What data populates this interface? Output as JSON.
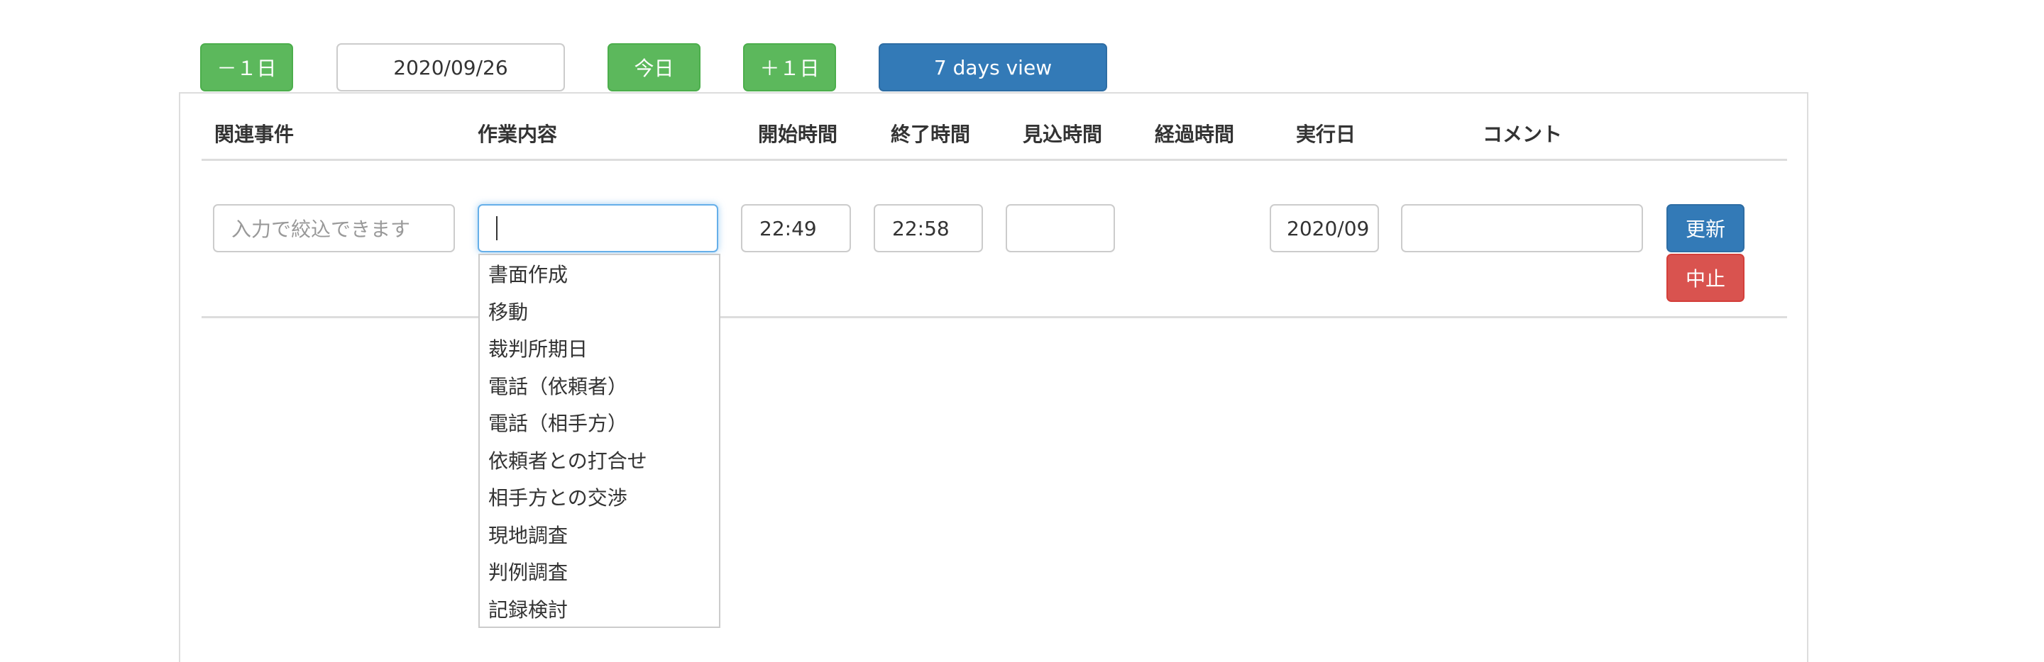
{
  "toolbar": {
    "prev_day": "－１日",
    "date": "2020/09/26",
    "today": "今日",
    "next_day": "＋１日",
    "week_view": "7 days view"
  },
  "table": {
    "headers": {
      "case": "関連事件",
      "task": "作業内容",
      "start": "開始時間",
      "end": "終了時間",
      "estimate": "見込時間",
      "elapsed": "経過時間",
      "exec_date": "実行日",
      "comment": "コメント"
    },
    "row": {
      "case_placeholder": "入力で絞込できます",
      "task_value": "",
      "start": "22:49",
      "end": "22:58",
      "estimate": "",
      "exec_date": "2020/09",
      "comment": "",
      "update_label": "更新",
      "cancel_label": "中止"
    }
  },
  "task_options": [
    "書面作成",
    "移動",
    "裁判所期日",
    "電話（依頼者）",
    "電話（相手方）",
    "依頼者との打合せ",
    "相手方との交渉",
    "現地調査",
    "判例調査",
    "記録検討"
  ]
}
